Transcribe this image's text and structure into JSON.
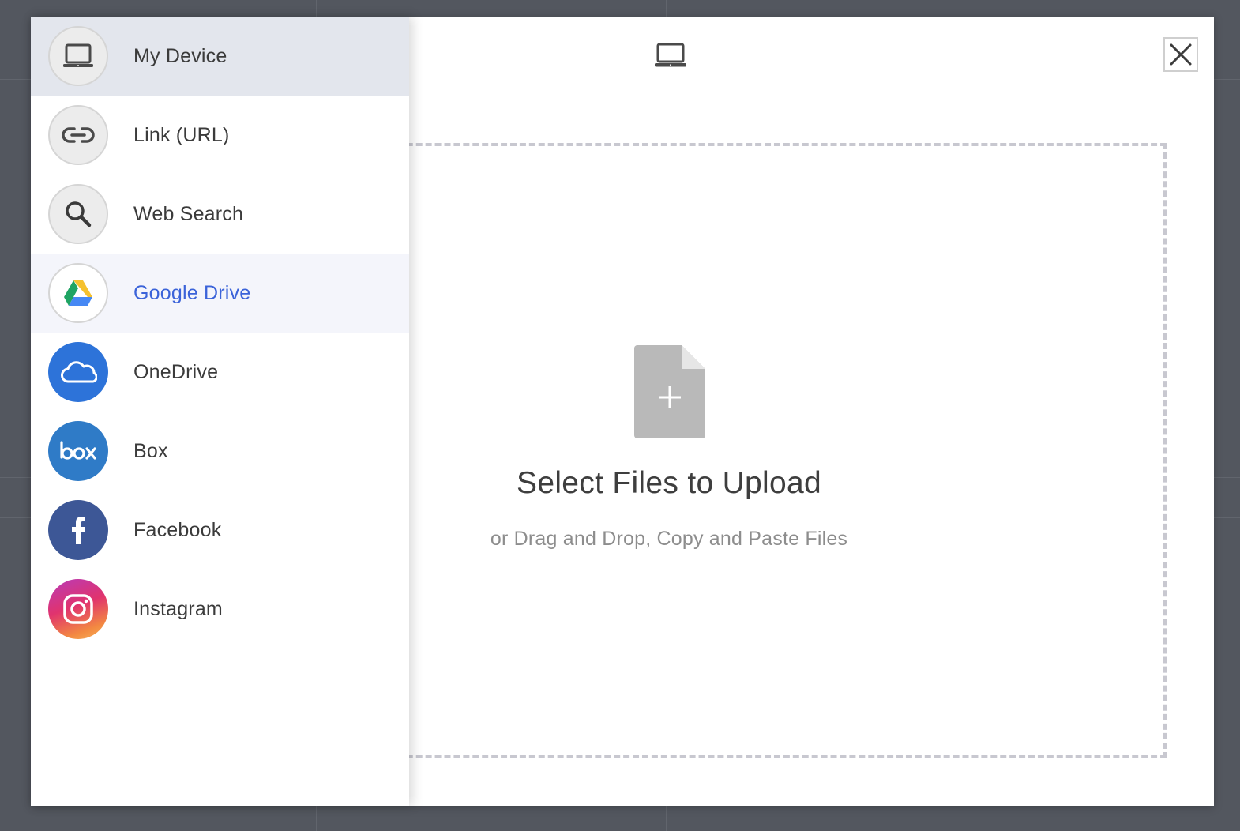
{
  "sources": [
    {
      "label": "My Device",
      "icon": "laptop-icon",
      "state": "active"
    },
    {
      "label": "Link (URL)",
      "icon": "link-icon",
      "state": "normal"
    },
    {
      "label": "Web Search",
      "icon": "search-icon",
      "state": "normal"
    },
    {
      "label": "Google Drive",
      "icon": "google-drive-icon",
      "state": "hover"
    },
    {
      "label": "OneDrive",
      "icon": "onedrive-icon",
      "state": "normal",
      "color": "#2d73d9"
    },
    {
      "label": "Box",
      "icon": "box-icon",
      "state": "normal",
      "color": "#2f7bc7"
    },
    {
      "label": "Facebook",
      "icon": "facebook-icon",
      "state": "normal",
      "color": "#3d5796"
    },
    {
      "label": "Instagram",
      "icon": "instagram-icon",
      "state": "normal"
    }
  ],
  "header": {
    "icon": "laptop-icon"
  },
  "close": {
    "icon": "close-icon"
  },
  "dropzone": {
    "title": "Select Files to Upload",
    "subtitle": "or Drag and Drop, Copy and Paste Files",
    "icon": "file-add-icon"
  },
  "colors": {
    "accent": "#3b63d9",
    "active_bg": "#e3e6ed",
    "hover_bg": "#f4f5fb"
  }
}
